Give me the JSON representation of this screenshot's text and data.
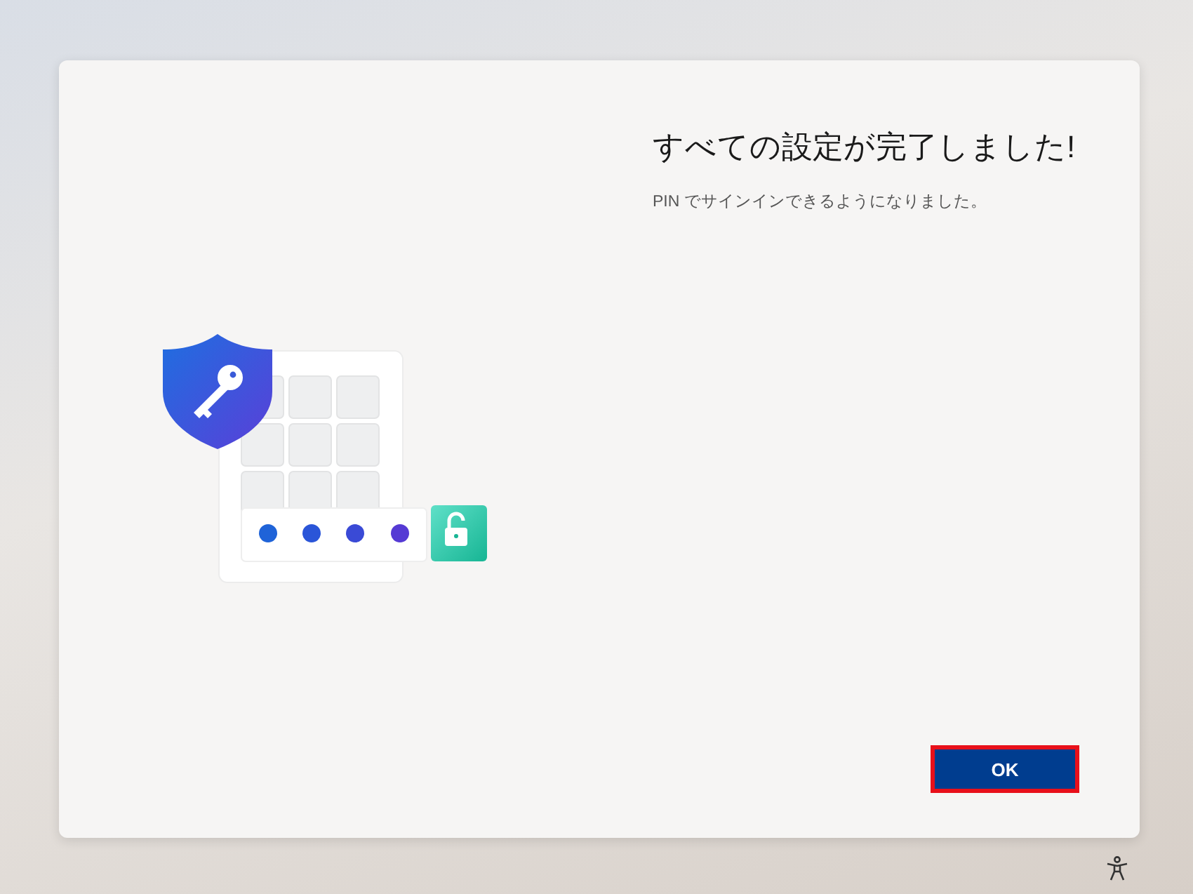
{
  "dialog": {
    "title": "すべての設定が完了しました!",
    "subtitle": "PIN でサインインできるようになりました。",
    "button": {
      "label": "OK",
      "highlighted": true
    }
  }
}
